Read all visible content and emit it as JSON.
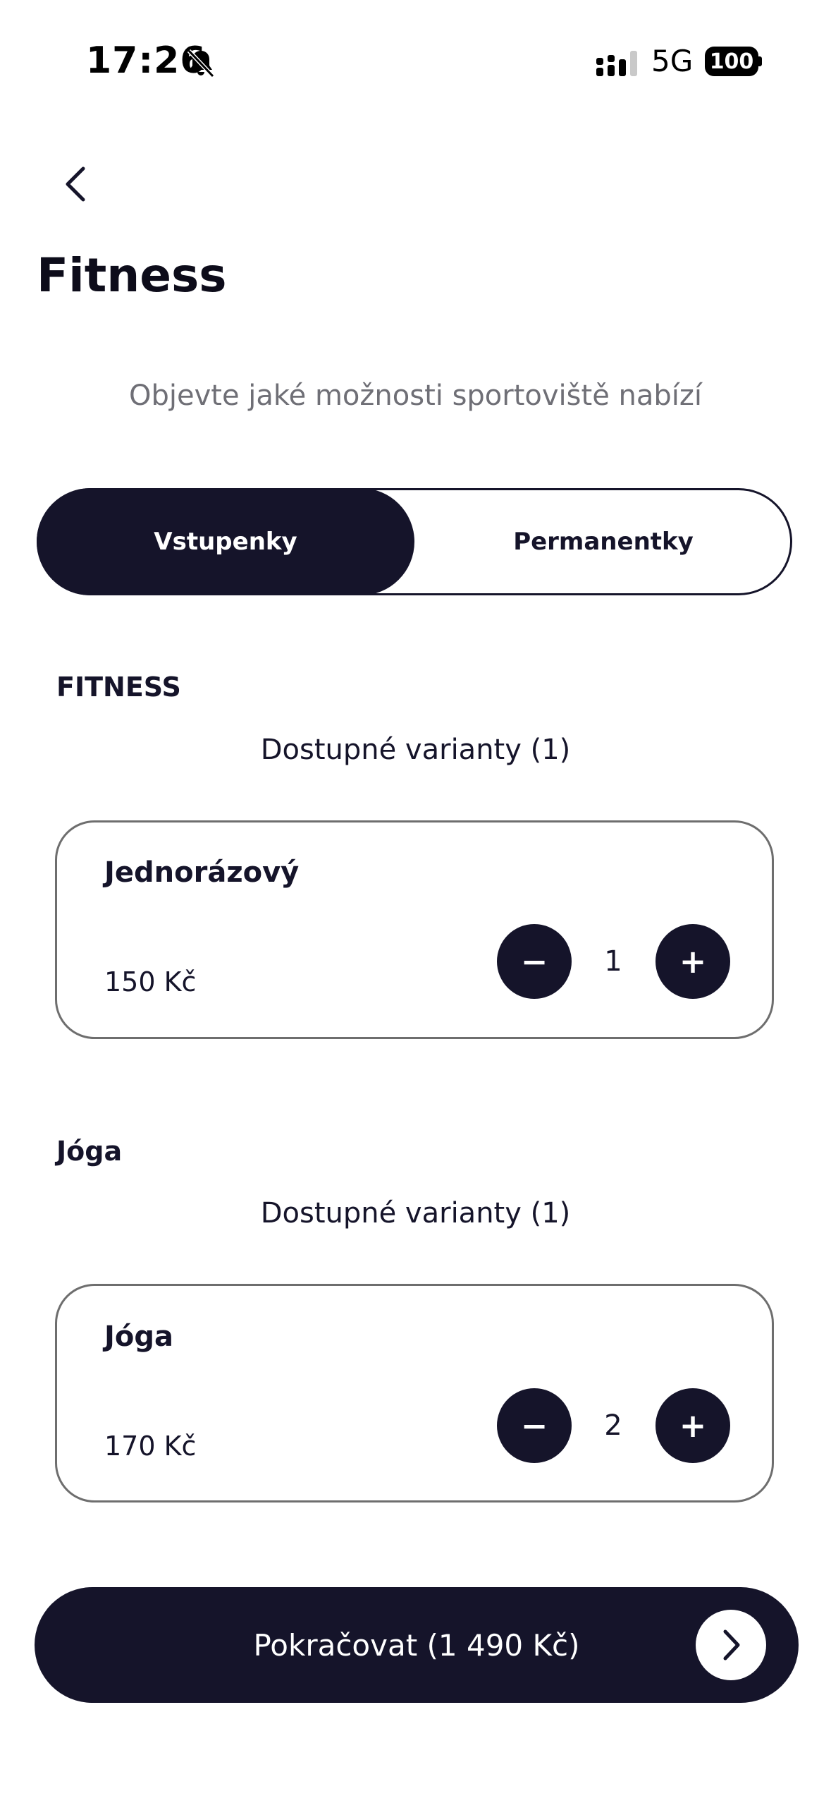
{
  "status_bar": {
    "time": "17:26",
    "network": "5G",
    "battery": "100",
    "icons": [
      "bell-muted-icon",
      "signal-icon",
      "battery-icon"
    ]
  },
  "header": {
    "back_icon": "chevron-left-icon",
    "title": "Fitness",
    "subtitle": "Objevte jaké možnosti sportoviště nabízí"
  },
  "tabs": {
    "items": [
      {
        "label": "Vstupenky",
        "selected": true
      },
      {
        "label": "Permanentky",
        "selected": false
      }
    ]
  },
  "sections": [
    {
      "label": "FITNESS",
      "variants_text": "Dostupné varianty (1)",
      "cards": [
        {
          "title": "Jednorázový",
          "price": "150 Kč",
          "quantity": "1",
          "minus": "−",
          "plus": "+"
        }
      ]
    },
    {
      "label": "Jóga",
      "variants_text": "Dostupné varianty (1)",
      "cards": [
        {
          "title": "Jóga",
          "price": "170 Kč",
          "quantity": "2",
          "minus": "−",
          "plus": "+"
        }
      ]
    }
  ],
  "footer": {
    "continue_label": "Pokračovat (1 490 Kč)",
    "continue_icon": "chevron-right-icon"
  },
  "colors": {
    "primary": "#15142a",
    "background": "#ffffff",
    "muted_text": "#6f6f76",
    "card_border": "#6e6e6e"
  }
}
